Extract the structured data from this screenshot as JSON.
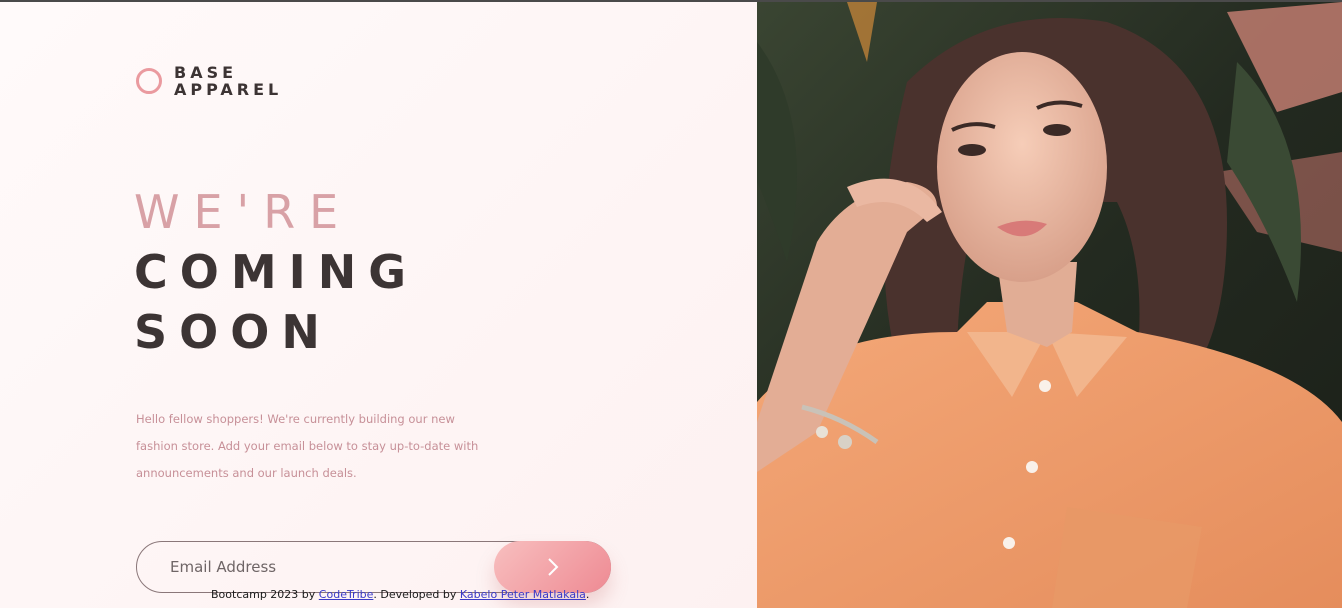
{
  "logo": {
    "line1": "BASE",
    "line2": "APPAREL"
  },
  "hero": {
    "line1": "WE'RE",
    "line2": "COMING",
    "line3": "SOON",
    "description": "Hello fellow shoppers! We're currently building our new fashion store. Add your email below to stay up-to-date with announcements and our launch deals."
  },
  "form": {
    "email_placeholder": "Email Address",
    "submit_icon": "chevron-right-icon"
  },
  "footer": {
    "prefix": "Bootcamp 2023 by ",
    "link1": "CodeTribe",
    "middle": ". Developed by ",
    "link2": "Kabelo Peter Matlakala",
    "suffix": "."
  },
  "colors": {
    "accent": "#ea9a9f",
    "heading_dark": "#3c3434",
    "heading_light": "#d8a1a6",
    "text": "#c79098"
  },
  "image": {
    "subject": "hero-photo"
  }
}
